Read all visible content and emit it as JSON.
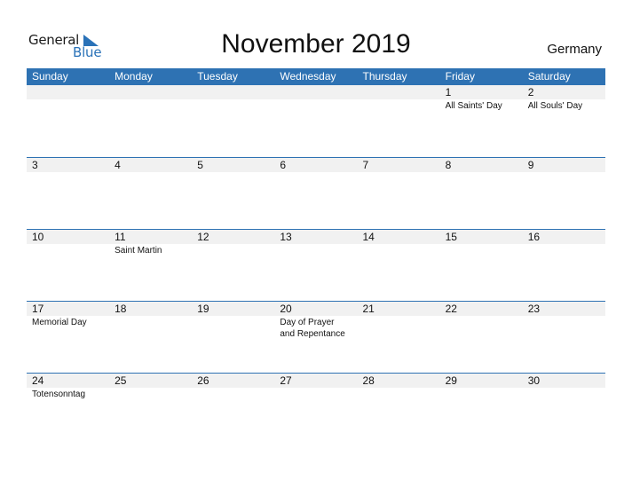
{
  "logo": {
    "general": "General",
    "blue": "Blue",
    "accent": "#2a72b8"
  },
  "title": "November 2019",
  "country": "Germany",
  "colors": {
    "header_bg": "#2e72b3",
    "date_row_bg": "#f1f1f1"
  },
  "weekdays": [
    "Sunday",
    "Monday",
    "Tuesday",
    "Wednesday",
    "Thursday",
    "Friday",
    "Saturday"
  ],
  "weeks": [
    {
      "days": [
        "",
        "",
        "",
        "",
        "",
        "1",
        "2"
      ],
      "holidays": [
        "",
        "",
        "",
        "",
        "",
        "All Saints' Day",
        "All Souls' Day"
      ]
    },
    {
      "days": [
        "3",
        "4",
        "5",
        "6",
        "7",
        "8",
        "9"
      ],
      "holidays": [
        "",
        "",
        "",
        "",
        "",
        "",
        ""
      ]
    },
    {
      "days": [
        "10",
        "11",
        "12",
        "13",
        "14",
        "15",
        "16"
      ],
      "holidays": [
        "",
        "Saint Martin",
        "",
        "",
        "",
        "",
        ""
      ]
    },
    {
      "days": [
        "17",
        "18",
        "19",
        "20",
        "21",
        "22",
        "23"
      ],
      "holidays": [
        "Memorial Day",
        "",
        "",
        "Day of Prayer and Repentance",
        "",
        "",
        ""
      ]
    },
    {
      "days": [
        "24",
        "25",
        "26",
        "27",
        "28",
        "29",
        "30"
      ],
      "holidays": [
        "Totensonntag",
        "",
        "",
        "",
        "",
        "",
        ""
      ]
    }
  ]
}
